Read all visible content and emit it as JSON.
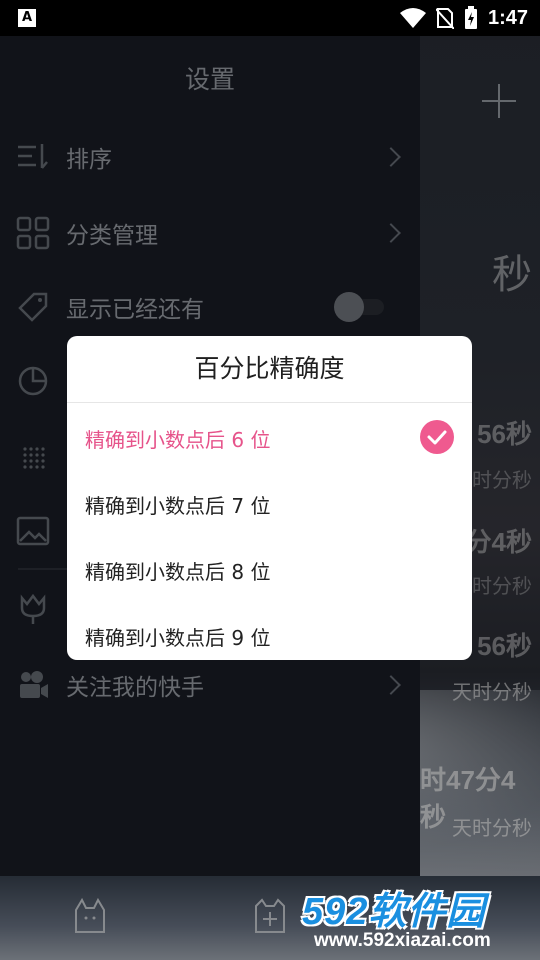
{
  "status_bar": {
    "app_badge": "A",
    "time": "1:47"
  },
  "drawer": {
    "title": "设置",
    "items": [
      {
        "label": "排序",
        "icon": "sort-icon",
        "has_chevron": true
      },
      {
        "label": "分类管理",
        "icon": "grid-icon",
        "has_chevron": true
      },
      {
        "label": "显示已经还有",
        "icon": "tag-icon",
        "has_toggle": true,
        "toggle_on": false
      },
      {
        "label": "",
        "icon": "pie-chart-icon"
      },
      {
        "label": "",
        "icon": "dots-grid-icon"
      },
      {
        "label": "",
        "icon": "image-icon"
      },
      {
        "label": "",
        "icon": "tulip-icon"
      },
      {
        "label": "关注我的快手",
        "icon": "camera-icon",
        "has_chevron": true
      }
    ]
  },
  "background": {
    "lines": [
      {
        "text": "秒",
        "y_hint": "large"
      },
      {
        "text": "56秒"
      },
      {
        "text": "天时分秒"
      },
      {
        "text": "分4秒"
      },
      {
        "text": "天时分秒"
      },
      {
        "text": "56秒"
      },
      {
        "text": "天时分秒"
      },
      {
        "text": "时47分4秒"
      },
      {
        "text": "天时分秒"
      }
    ]
  },
  "dialog": {
    "title": "百分比精确度",
    "options": [
      {
        "label": "精确到小数点后 6 位",
        "selected": true
      },
      {
        "label": "精确到小数点后 7 位",
        "selected": false
      },
      {
        "label": "精确到小数点后 8 位",
        "selected": false
      },
      {
        "label": "精确到小数点后 9 位",
        "selected": false
      }
    ]
  },
  "watermark": {
    "brand": "592软件园",
    "url": "www.592xiazai.com"
  },
  "colors": {
    "accent": "#ef5a8f",
    "drawer_bg": "#1b1e27",
    "drawer_text": "#9ea3ab"
  }
}
